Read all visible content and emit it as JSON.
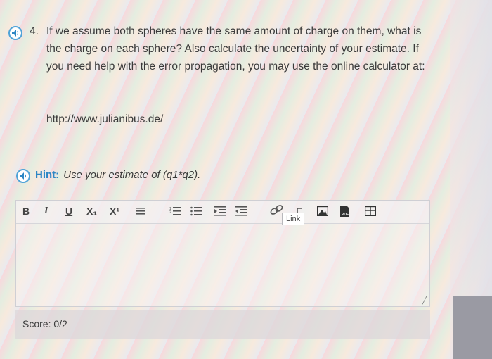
{
  "question": {
    "number": "4.",
    "text": "If we assume both spheres have the same amount of charge on them, what is the charge on each sphere? Also calculate the uncertainty of your estimate. If you need help with the error propagation, you may use the online calculator at:",
    "url": "http://www.julianibus.de/"
  },
  "hint": {
    "label": "Hint:",
    "text": "Use your estimate of (q1*q2)."
  },
  "toolbar": {
    "bold": "B",
    "italic": "I",
    "underline": "U",
    "subscript": "X₁",
    "superscript": "X¹",
    "link_tooltip": "Link"
  },
  "score": {
    "label": "Score:",
    "value": "0/2"
  },
  "colors": {
    "accent": "#2d86c4",
    "audio_border": "#4fa3d8"
  }
}
